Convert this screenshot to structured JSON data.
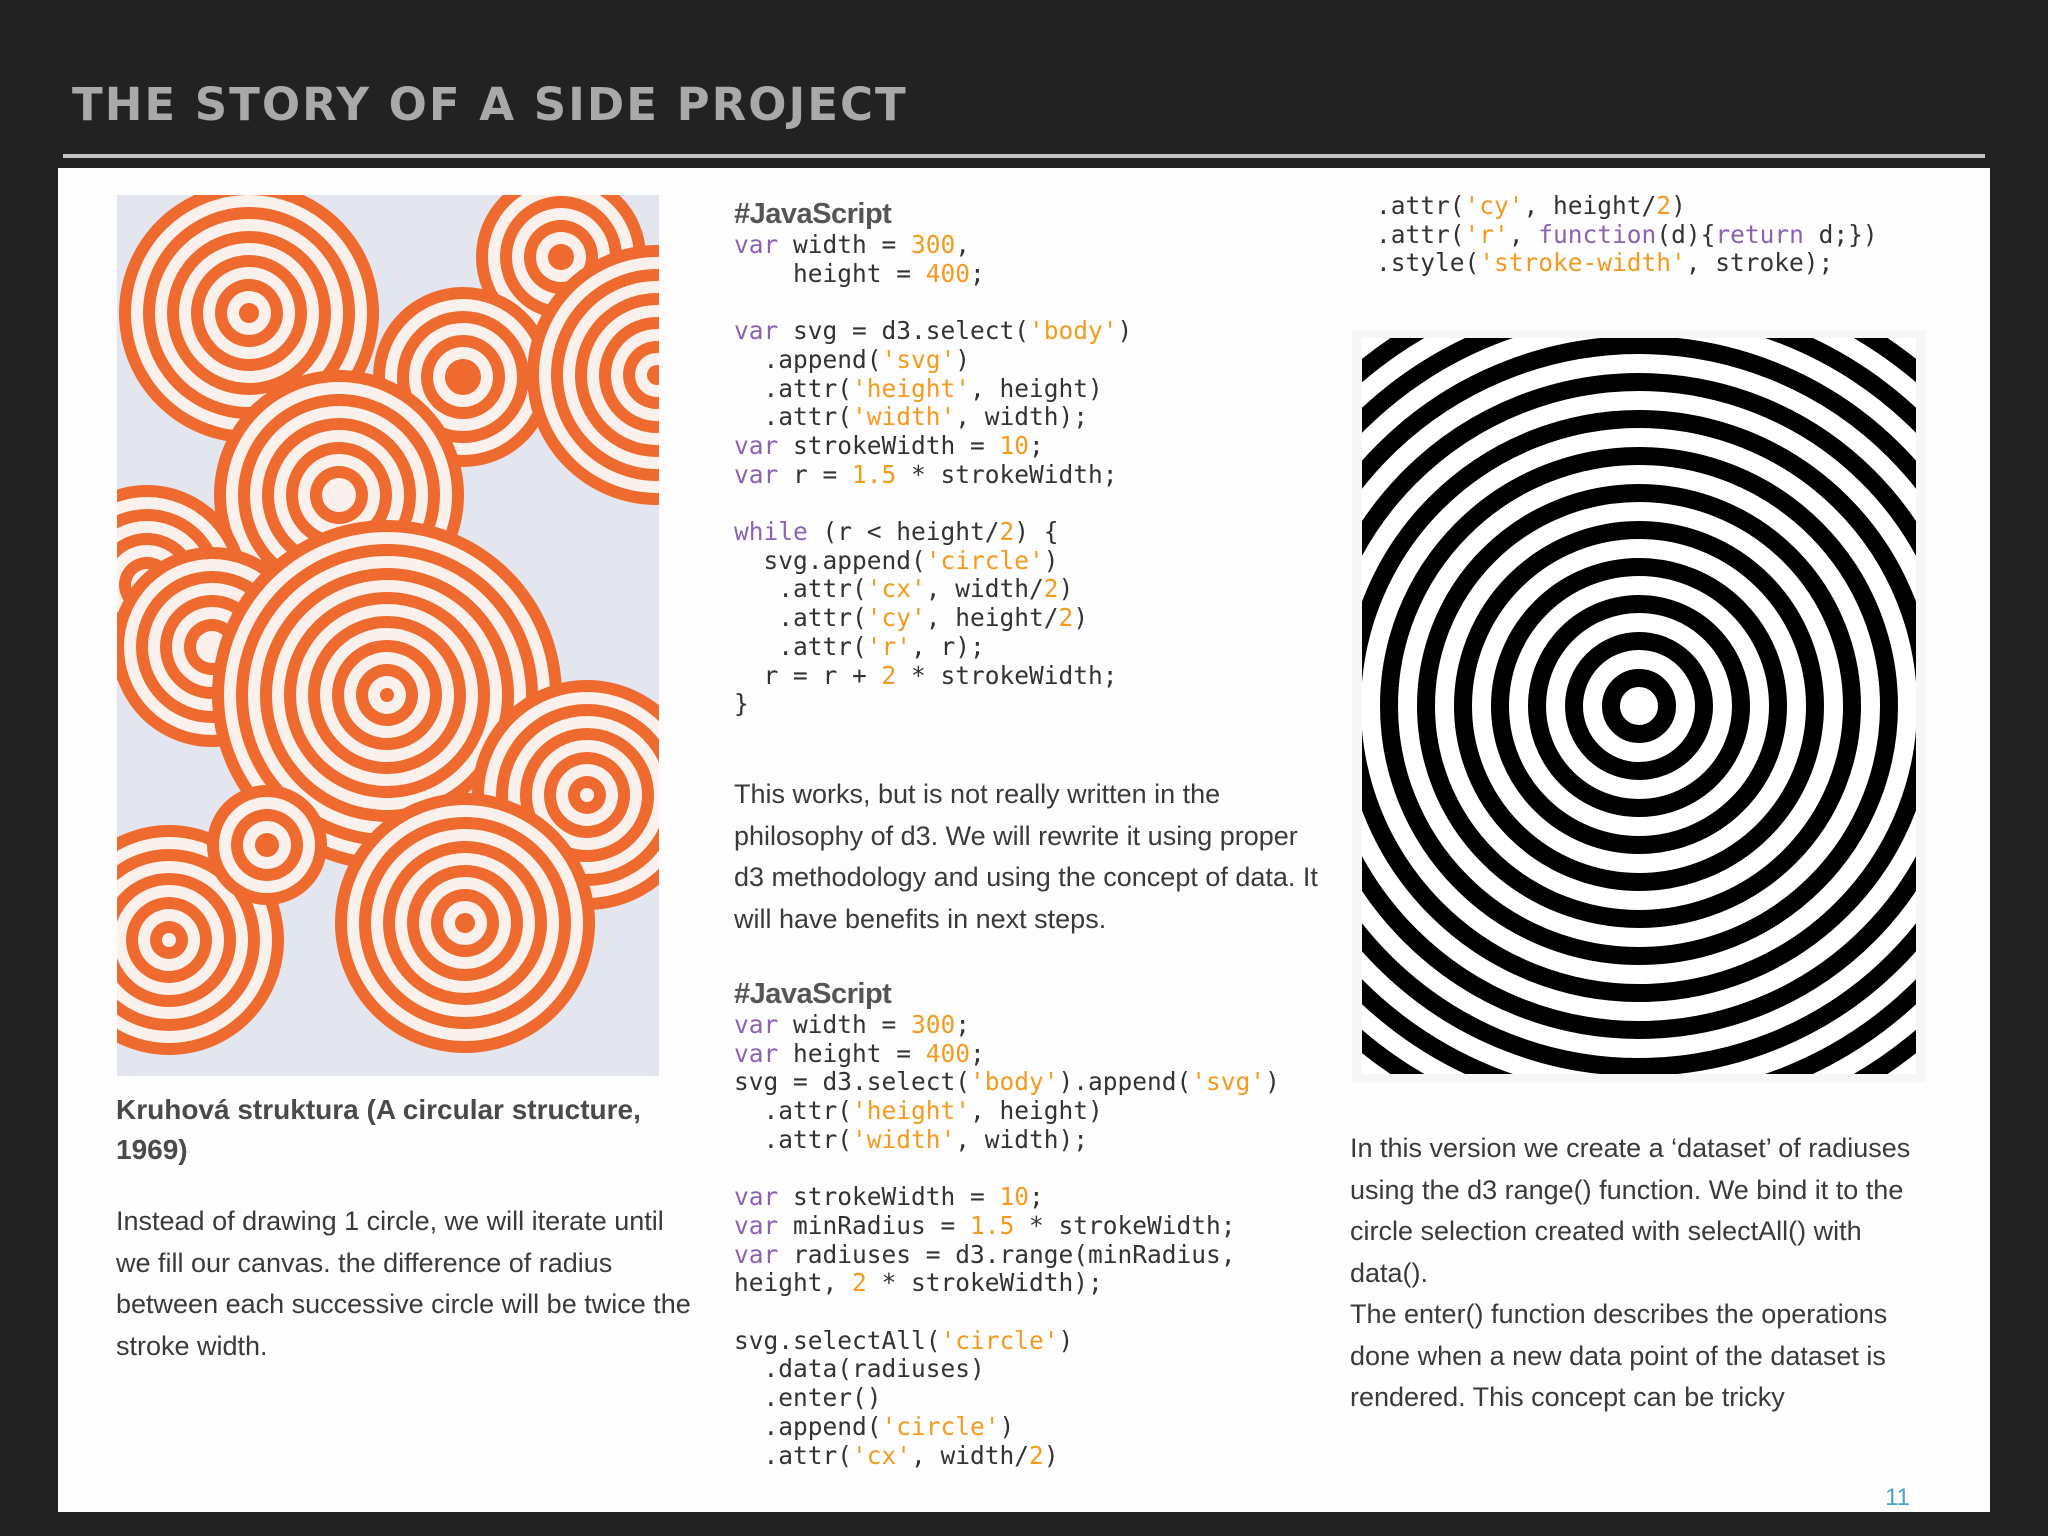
{
  "slide": {
    "title": "THE STORY OF A SIDE PROJECT",
    "page_number": "11"
  },
  "left": {
    "image_alt": "Kruhová struktura painting",
    "caption": "Kruhová struktura (A circular structure, 1969)",
    "paragraph": "Instead of drawing 1 circle, we will iterate until we fill our canvas. the difference of radius between each successive circle will be twice the stroke width."
  },
  "middle": {
    "code1_heading": "#JavaScript",
    "code1_lines": [
      [
        [
          "kw",
          "var"
        ],
        [
          "p",
          " width = "
        ],
        [
          "num",
          "300"
        ],
        [
          "p",
          ","
        ]
      ],
      [
        [
          "p",
          "    height = "
        ],
        [
          "num",
          "400"
        ],
        [
          "p",
          ";"
        ]
      ],
      [
        [
          "p",
          ""
        ]
      ],
      [
        [
          "kw",
          "var"
        ],
        [
          "p",
          " svg = d3.select("
        ],
        [
          "str",
          "'body'"
        ],
        [
          "p",
          ")"
        ]
      ],
      [
        [
          "p",
          "  .append("
        ],
        [
          "str",
          "'svg'"
        ],
        [
          "p",
          ")"
        ]
      ],
      [
        [
          "p",
          "  .attr("
        ],
        [
          "str",
          "'height'"
        ],
        [
          "p",
          ", height)"
        ]
      ],
      [
        [
          "p",
          "  .attr("
        ],
        [
          "str",
          "'width'"
        ],
        [
          "p",
          ", width);"
        ]
      ],
      [
        [
          "kw",
          "var"
        ],
        [
          "p",
          " strokeWidth = "
        ],
        [
          "num",
          "10"
        ],
        [
          "p",
          ";"
        ]
      ],
      [
        [
          "kw",
          "var"
        ],
        [
          "p",
          " r = "
        ],
        [
          "num",
          "1.5"
        ],
        [
          "p",
          " * strokeWidth;"
        ]
      ],
      [
        [
          "p",
          ""
        ]
      ],
      [
        [
          "kw",
          "while"
        ],
        [
          "p",
          " (r < height/"
        ],
        [
          "num",
          "2"
        ],
        [
          "p",
          ") {"
        ]
      ],
      [
        [
          "p",
          "  svg.append("
        ],
        [
          "str",
          "'circle'"
        ],
        [
          "p",
          ")"
        ]
      ],
      [
        [
          "p",
          "   .attr("
        ],
        [
          "str",
          "'cx'"
        ],
        [
          "p",
          ", width/"
        ],
        [
          "num",
          "2"
        ],
        [
          "p",
          ")"
        ]
      ],
      [
        [
          "p",
          "   .attr("
        ],
        [
          "str",
          "'cy'"
        ],
        [
          "p",
          ", height/"
        ],
        [
          "num",
          "2"
        ],
        [
          "p",
          ")"
        ]
      ],
      [
        [
          "p",
          "   .attr("
        ],
        [
          "str",
          "'r'"
        ],
        [
          "p",
          ", r);"
        ]
      ],
      [
        [
          "p",
          "  r = r + "
        ],
        [
          "num",
          "2"
        ],
        [
          "p",
          " * strokeWidth;"
        ]
      ],
      [
        [
          "p",
          "}"
        ]
      ]
    ],
    "paragraph": "This works, but is not really written in the philosophy of d3. We will rewrite it using proper d3 methodology and using the concept of data. It will have benefits in next steps.",
    "code2_heading": "#JavaScript",
    "code2_lines": [
      [
        [
          "kw",
          "var"
        ],
        [
          "p",
          " width = "
        ],
        [
          "num",
          "300"
        ],
        [
          "p",
          ";"
        ]
      ],
      [
        [
          "kw",
          "var"
        ],
        [
          "p",
          " height = "
        ],
        [
          "num",
          "400"
        ],
        [
          "p",
          ";"
        ]
      ],
      [
        [
          "p",
          "svg = d3.select("
        ],
        [
          "str",
          "'body'"
        ],
        [
          "p",
          ").append("
        ],
        [
          "str",
          "'svg'"
        ],
        [
          "p",
          ")"
        ]
      ],
      [
        [
          "p",
          "  .attr("
        ],
        [
          "str",
          "'height'"
        ],
        [
          "p",
          ", height)"
        ]
      ],
      [
        [
          "p",
          "  .attr("
        ],
        [
          "str",
          "'width'"
        ],
        [
          "p",
          ", width);"
        ]
      ],
      [
        [
          "p",
          ""
        ]
      ],
      [
        [
          "kw",
          "var"
        ],
        [
          "p",
          " strokeWidth = "
        ],
        [
          "num",
          "10"
        ],
        [
          "p",
          ";"
        ]
      ],
      [
        [
          "kw",
          "var"
        ],
        [
          "p",
          " minRadius = "
        ],
        [
          "num",
          "1.5"
        ],
        [
          "p",
          " * strokeWidth;"
        ]
      ],
      [
        [
          "kw",
          "var"
        ],
        [
          "p",
          " radiuses = d3.range(minRadius,"
        ]
      ],
      [
        [
          "p",
          "height, "
        ],
        [
          "num",
          "2"
        ],
        [
          "p",
          " * strokeWidth);"
        ]
      ],
      [
        [
          "p",
          ""
        ]
      ],
      [
        [
          "p",
          "svg.selectAll("
        ],
        [
          "str",
          "'circle'"
        ],
        [
          "p",
          ")"
        ]
      ],
      [
        [
          "p",
          "  .data(radiuses)"
        ]
      ],
      [
        [
          "p",
          "  .enter()"
        ]
      ],
      [
        [
          "p",
          "  .append("
        ],
        [
          "str",
          "'circle'"
        ],
        [
          "p",
          ")"
        ]
      ],
      [
        [
          "p",
          "  .attr("
        ],
        [
          "str",
          "'cx'"
        ],
        [
          "p",
          ", width/"
        ],
        [
          "num",
          "2"
        ],
        [
          "p",
          ")"
        ]
      ]
    ]
  },
  "right": {
    "code_lines": [
      [
        [
          "p",
          ".attr("
        ],
        [
          "str",
          "'cy'"
        ],
        [
          "p",
          ", height/"
        ],
        [
          "num",
          "2"
        ],
        [
          "p",
          ")"
        ]
      ],
      [
        [
          "p",
          ".attr("
        ],
        [
          "str",
          "'r'"
        ],
        [
          "p",
          ", "
        ],
        [
          "kw",
          "function"
        ],
        [
          "p",
          "(d){"
        ],
        [
          "kw",
          "return"
        ],
        [
          "p",
          " d;})"
        ]
      ],
      [
        [
          "p",
          ".style("
        ],
        [
          "str",
          "'stroke-width'"
        ],
        [
          "p",
          ", stroke);"
        ]
      ]
    ],
    "image_alt": "Concentric black circles rendered by d3",
    "paragraph1": "In this version we create a ‘dataset’ of radiuses using the d3 range() function. We bind it to the circle selection  created with selectAll() with data().",
    "paragraph2": "The enter() function describes the operations done when a new data point of the dataset is rendered. This concept can be tricky"
  },
  "colors": {
    "background": "#222222",
    "page": "#fdfdfd",
    "keyword": "#8c63b0",
    "literal": "#f39b1f",
    "page_number": "#4aa3c8",
    "pattern_orange": "#ef6a2e"
  }
}
